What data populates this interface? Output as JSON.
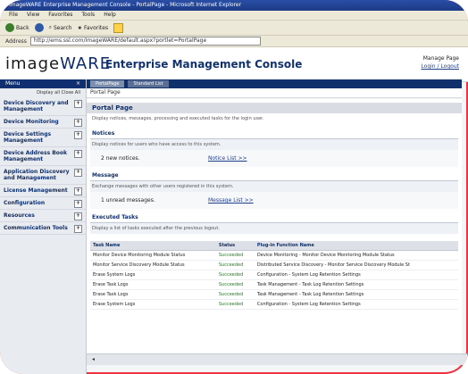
{
  "browser": {
    "title": "ImageWARE Enterprise Management Console - PortalPage - Microsoft Internet Explorer",
    "menu": [
      "File",
      "View",
      "Favorites",
      "Tools",
      "Help"
    ],
    "toolbar": {
      "back": "Back",
      "search": "Search",
      "favorites": "Favorites"
    },
    "address_label": "Address",
    "address_value": "http://ems.ssl.com/ImageWARE/default.aspx?portlet=PortalPage"
  },
  "header": {
    "logo_image": "image",
    "logo_ware": "WARE",
    "app_title": "Enterprise Management Console",
    "user_label": "Manage Page",
    "logout_label": "Login / Logout"
  },
  "sidebar": {
    "heading": "Menu",
    "close": "×",
    "display_label": "Display all Close All",
    "items": [
      {
        "label": "Device Discovery and Management",
        "exp": "+"
      },
      {
        "label": "Device Monitoring",
        "exp": "+"
      },
      {
        "label": "Device Settings Management",
        "exp": "+"
      },
      {
        "label": "Device Address Book Management",
        "exp": "+"
      },
      {
        "label": "Application Discovery and Management",
        "exp": "+"
      },
      {
        "label": "License Management",
        "exp": "+"
      },
      {
        "label": "Configuration",
        "exp": "+"
      },
      {
        "label": "Resources",
        "exp": "+"
      },
      {
        "label": "Communication Tools",
        "exp": "+"
      }
    ]
  },
  "tabs": [
    {
      "label": "PortalPage"
    },
    {
      "label": "Standard List"
    }
  ],
  "breadcrumb": "Portal Page",
  "page": {
    "title": "Portal Page",
    "description": "Display notices, messages, processing and executed tasks for the login user."
  },
  "notices": {
    "heading": "Notices",
    "description": "Display notices for users who have access to this system.",
    "count_text": "2 new notices.",
    "link": "Notice List >>"
  },
  "messages": {
    "heading": "Message",
    "description": "Exchange messages with other users registered in this system.",
    "count_text": "1 unread messages.",
    "link": "Message List >>"
  },
  "executed": {
    "heading": "Executed Tasks",
    "description": "Display a list of tasks executed after the previous logout.",
    "columns": [
      "Task Name",
      "Status",
      "Plug-in Function Name"
    ],
    "rows": [
      [
        "Monitor Device Monitoring Module Status",
        "Succeeded",
        "Device Monitoring - Monitor Device Monitoring Module Status"
      ],
      [
        "Monitor Service Discovery Module Status",
        "Succeeded",
        "Distributed Service Discovery - Monitor Service Discovery Module St"
      ],
      [
        "Erase System Logs",
        "Succeeded",
        "Configuration - System Log Retention Settings"
      ],
      [
        "Erase Task Logs",
        "Succeeded",
        "Task Management - Task Log Retention Settings"
      ],
      [
        "Erase Task Logs",
        "Succeeded",
        "Task Management - Task Log Retention Settings"
      ],
      [
        "Erase System Logs",
        "Succeeded",
        "Configuration - System Log Retention Settings"
      ]
    ]
  },
  "footer": "◂"
}
